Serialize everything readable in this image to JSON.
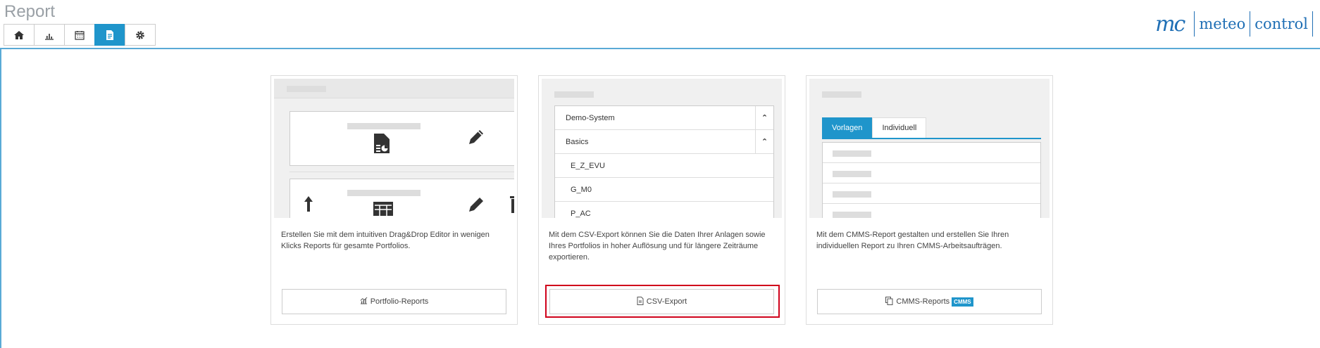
{
  "header": {
    "title": "Report",
    "nav": [
      {
        "icon": "home-icon"
      },
      {
        "icon": "chart-icon"
      },
      {
        "icon": "calendar-icon"
      },
      {
        "icon": "document-icon",
        "active": true
      },
      {
        "icon": "gear-icon"
      }
    ],
    "brand": {
      "mark": "mc",
      "word1": "meteo",
      "word2": "control"
    }
  },
  "cards": [
    {
      "description": "Erstellen Sie mit dem intuitiven Drag&Drop Editor in wenigen Klicks Reports für gesamte Portfolios.",
      "button_label": "Portfolio-Reports",
      "button_icon": "chart-icon"
    },
    {
      "description": "Mit dem CSV-Export können Sie die Daten Ihrer Anlagen sowie Ihres Portfolios in hoher Auflösung und für längere Zeiträume exportieren.",
      "button_label": "CSV-Export",
      "button_icon": "file-icon",
      "tree": [
        "Demo-System",
        "Basics",
        "E_Z_EVU",
        "G_M0",
        "P_AC"
      ]
    },
    {
      "description": "Mit dem CMMS-Report gestalten und erstellen Sie Ihren individuellen Report zu Ihren CMMS-Arbeitsaufträgen.",
      "button_label": "CMMS-Reports",
      "button_icon": "copy-icon",
      "badge": "CMMS",
      "tabs": [
        "Vorlagen",
        "Individuell"
      ]
    }
  ],
  "colors": {
    "accent": "#1f95cb",
    "brand": "#1f6fb5",
    "highlight": "#d0021b"
  }
}
